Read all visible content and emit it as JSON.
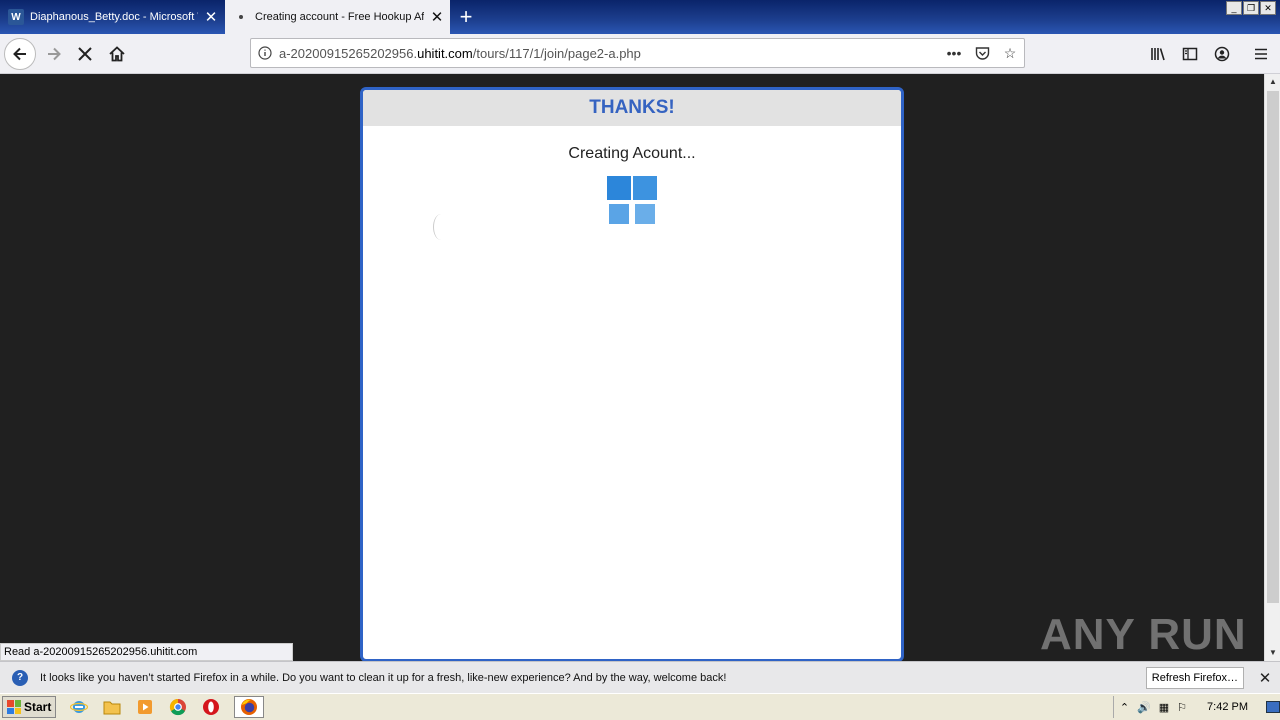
{
  "tabs": [
    {
      "title": "Diaphanous_Betty.doc - Microsoft Word",
      "icon": "word-icon"
    },
    {
      "title": "Creating account - Free Hookup Affairs",
      "icon": "loading-dot-icon"
    }
  ],
  "new_tab_label": "+",
  "window_controls": {
    "minimize": "_",
    "restore": "❐",
    "close": "✕"
  },
  "address": {
    "prefix": "a-20200915265202956.",
    "domain": "uhitit.com",
    "path": "/tours/117/1/join/page2-a.php"
  },
  "page": {
    "title": "THANKS!",
    "status": "Creating Acount...",
    "loader_colors": [
      "#2c86da",
      "#3d93e0",
      "#5aa4e6",
      "#6aaee9"
    ],
    "accent": "#2f63c6"
  },
  "status_overlay": "Read a-20200915265202956.uhitit.com",
  "watermark": "ANY RUN",
  "notification": {
    "text": "It looks like you haven’t started Firefox in a while. Do you want to clean it up for a fresh, like-new experience? And by the way, welcome back!",
    "button": "Refresh Firefox…"
  },
  "taskbar": {
    "start": "Start",
    "clock": "7:42 PM"
  }
}
